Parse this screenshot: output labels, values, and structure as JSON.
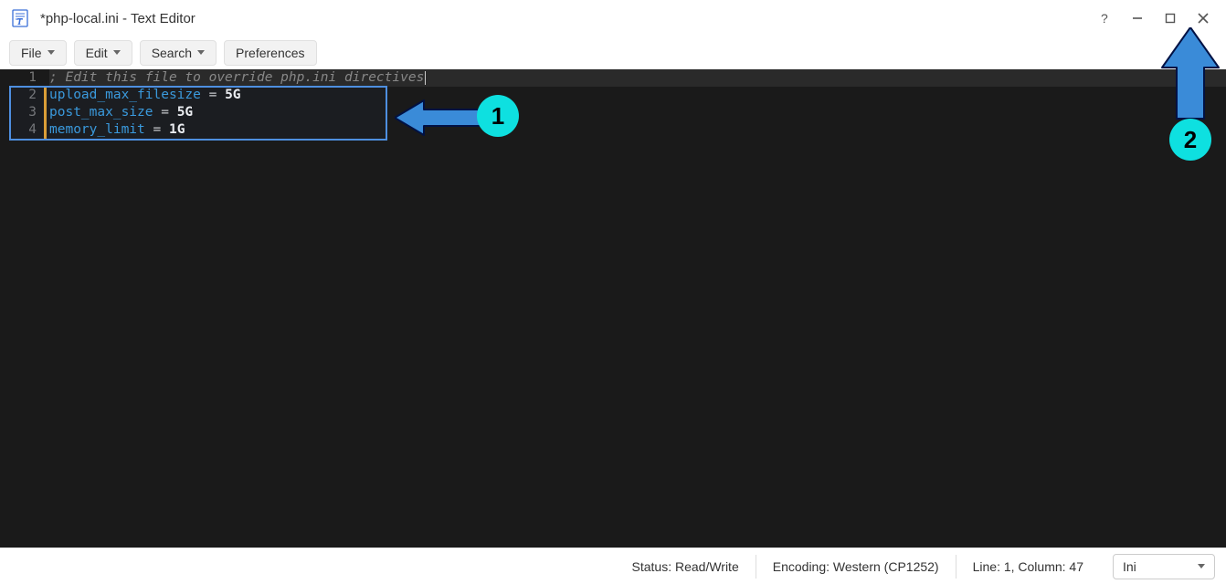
{
  "window": {
    "title": "*php-local.ini - Text Editor"
  },
  "menus": {
    "file": "File",
    "edit": "Edit",
    "search": "Search",
    "preferences": "Preferences"
  },
  "editor": {
    "lines": [
      {
        "num": "1",
        "type": "comment",
        "text": "; Edit this file to override php.ini directives",
        "current": true
      },
      {
        "num": "2",
        "type": "kv",
        "key": "upload_max_filesize",
        "eq": " = ",
        "val": "5G",
        "modified": true
      },
      {
        "num": "3",
        "type": "kv",
        "key": "post_max_size",
        "eq": " = ",
        "val": "5G",
        "modified": true
      },
      {
        "num": "4",
        "type": "kv",
        "key": "memory_limit",
        "eq": " = ",
        "val": "1G",
        "modified": true
      }
    ]
  },
  "status": {
    "rw": "Status: Read/Write",
    "encoding": "Encoding: Western (CP1252)",
    "position": "Line: 1, Column: 47",
    "language": "Ini"
  },
  "annotations": {
    "one": "1",
    "two": "2"
  }
}
